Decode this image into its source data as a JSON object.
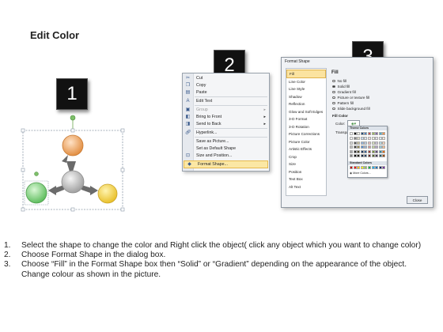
{
  "title": "Edit Color",
  "steps": [
    "1",
    "2",
    "3"
  ],
  "context_menu": {
    "items": [
      {
        "label": "Cut",
        "icon": "scissors-icon"
      },
      {
        "label": "Copy",
        "icon": "copy-icon"
      },
      {
        "label": "Paste",
        "icon": "paste-icon"
      },
      {
        "label": "Edit Text",
        "icon": "edit-text-icon"
      },
      {
        "label": "Group",
        "icon": "group-icon",
        "submenu": true
      },
      {
        "label": "Bring to Front",
        "icon": "bring-front-icon",
        "submenu": true
      },
      {
        "label": "Send to Back",
        "icon": "send-back-icon",
        "submenu": true
      },
      {
        "label": "Hyperlink...",
        "icon": "hyperlink-icon"
      },
      {
        "label": "Save as Picture...",
        "icon": ""
      },
      {
        "label": "Set as Default Shape",
        "icon": ""
      },
      {
        "label": "Size and Position...",
        "icon": "size-icon"
      },
      {
        "label": "Format Shape...",
        "icon": "format-shape-icon"
      }
    ]
  },
  "dialog": {
    "title": "Format Shape",
    "categories": [
      "Fill",
      "Line Color",
      "Line Style",
      "Shadow",
      "Reflection",
      "Glow and Soft Edges",
      "3-D Format",
      "3-D Rotation",
      "Picture Corrections",
      "Picture Color",
      "Artistic Effects",
      "Crop",
      "Size",
      "Position",
      "Text Box",
      "Alt Text"
    ],
    "fill_heading": "Fill",
    "fill_options": [
      {
        "label": "No fill",
        "selected": false
      },
      {
        "label": "Solid fill",
        "selected": true
      },
      {
        "label": "Gradient fill",
        "selected": false
      },
      {
        "label": "Picture or texture fill",
        "selected": false
      },
      {
        "label": "Pattern fill",
        "selected": false
      },
      {
        "label": "Slide background fill",
        "selected": false
      }
    ],
    "fill_color_label": "Fill Color",
    "color_label": "Color:",
    "transparency_label": "Transpa",
    "palette": {
      "theme_label": "Theme Colors",
      "standard_label": "Standard Colors",
      "more_label": "More Colors..."
    },
    "close_label": "Close"
  },
  "diagram": {
    "center_color": "#b8b8b8",
    "top_color": "#f0a060",
    "right_color": "#f5d24a",
    "left_color": "#7fd47f"
  },
  "instructions": [
    {
      "n": "1.",
      "text": "Select the shape to change the color and Right click the object( click any object which you want to change color)"
    },
    {
      "n": "2.",
      "text": "Choose Format Shape in the dialog box."
    },
    {
      "n": "3.",
      "text": "Choose “Fill” in the Format Shape box then “Solid” or “Gradient” depending on the appearance of the object. Change colour as shown in the picture."
    }
  ]
}
